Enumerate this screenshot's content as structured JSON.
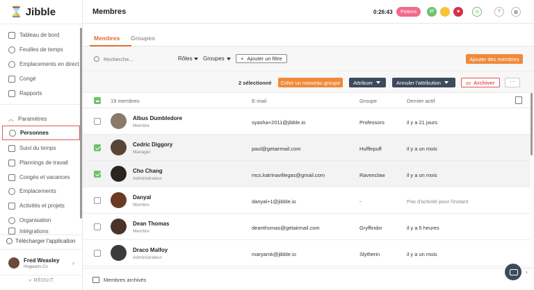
{
  "brand": {
    "name": "Jibble",
    "mark": "⌛"
  },
  "sidebar": {
    "top_items": [
      {
        "label": "Tableau de bord"
      },
      {
        "label": "Feuilles de temps"
      },
      {
        "label": "Emplacements en direct"
      },
      {
        "label": "Congé"
      },
      {
        "label": "Rapports"
      }
    ],
    "settings_label": "Paramètres",
    "settings_items": [
      {
        "label": "Personnes"
      },
      {
        "label": "Suivi du temps"
      },
      {
        "label": "Plannings de travail"
      },
      {
        "label": "Congés et vacances"
      },
      {
        "label": "Emplacements"
      },
      {
        "label": "Activités et projets"
      },
      {
        "label": "Organisation"
      },
      {
        "label": "Intégrations"
      }
    ],
    "download_app": "Télécharger l'application",
    "user": {
      "name": "Fred Weasley",
      "org": "Hogwarts Co"
    },
    "reduce_label": "« RÉDUIT"
  },
  "topbar": {
    "title": "Membres",
    "timer": "0:26:43",
    "project_badge": "Potions",
    "circles": [
      {
        "text": "37",
        "color": "#6cc26c"
      },
      {
        "text": "⚡",
        "color": "#f5c33b"
      },
      {
        "text": "■",
        "color": "#d9304a"
      }
    ]
  },
  "tabs": [
    {
      "label": "Membres"
    },
    {
      "label": "Groupes"
    }
  ],
  "filters": {
    "search_placeholder": "Recherche...",
    "roles_label": "Rôles",
    "groups_label": "Groupes",
    "add_filter_label": "Ajouter un filtre",
    "add_members_label": "Ajouter des membres"
  },
  "actions": {
    "selected_count": "2 sélectionné",
    "create_group": "Créer un nouveau groupe",
    "assign": "Attribuer",
    "unassign": "Annuler l'attribution",
    "archive": "Archiver",
    "more": "···"
  },
  "table": {
    "headers": {
      "members": "19 membres",
      "email": "E-mail",
      "group": "Groupe",
      "last_active": "Dernier actif"
    },
    "rows": [
      {
        "name": "Albus Dumbledore",
        "role": "Membre",
        "email": "syasha+2011@jibble.io",
        "group": "Professors",
        "last_active": "il y a 21 jours",
        "selected": false,
        "avatar_color": "#8a7a6a"
      },
      {
        "name": "Cedric Diggory",
        "role": "Manager",
        "email": "paul@getairmail.com",
        "group": "Hufflepuff",
        "last_active": "il y a un mois",
        "selected": true,
        "avatar_color": "#5a4434"
      },
      {
        "name": "Cho Chang",
        "role": "Administrateur",
        "email": "mcs.katrinavillegas@gmail.com",
        "group": "Ravenclaw",
        "last_active": "il y a un mois",
        "selected": true,
        "avatar_color": "#2a2420"
      },
      {
        "name": "Danyal",
        "role": "Membre",
        "email": "danyal+1@jibble.io",
        "group": "-",
        "last_active": "Pas d'activité pour l'instant",
        "selected": false,
        "avatar_color": "#6a3a22"
      },
      {
        "name": "Dean Thomas",
        "role": "Membre",
        "email": "deanthomas@getairmail.com",
        "group": "Gryffindor",
        "last_active": "il y a 5 heures",
        "selected": false,
        "avatar_color": "#4a3428"
      },
      {
        "name": "Draco Malfoy",
        "role": "Administrateur",
        "email": "maryamk@jibble.io",
        "group": "Slytherin",
        "last_active": "il y a un mois",
        "selected": false,
        "avatar_color": "#3a3a3a"
      }
    ]
  },
  "footer": {
    "archived_label": "Membres archivés"
  }
}
